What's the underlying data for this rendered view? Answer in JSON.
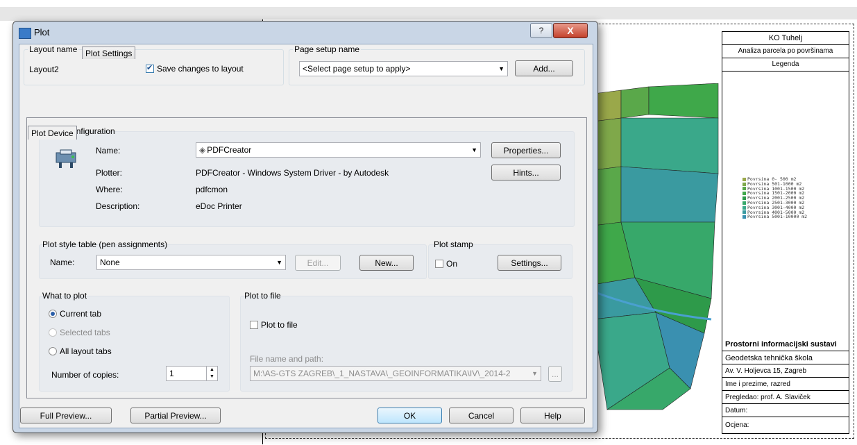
{
  "dialog": {
    "title": "Plot",
    "help_glyph": "?",
    "close_glyph": "X",
    "layout_name": {
      "label": "Layout name",
      "value": "Layout2",
      "save_changes_label": "Save changes to layout",
      "save_changes_checked": true
    },
    "page_setup": {
      "label": "Page setup name",
      "value": "<Select page setup to apply>",
      "add_button": "Add..."
    },
    "tabs": [
      {
        "label": "Plot Device",
        "active": true
      },
      {
        "label": "Plot Settings",
        "active": false
      }
    ],
    "plotter_configuration": {
      "label": "Plotter configuration",
      "name_label": "Name:",
      "name_value": "PDFCreator",
      "plotter_label": "Plotter:",
      "plotter_value": "PDFCreator - Windows System Driver - by Autodesk",
      "where_label": "Where:",
      "where_value": "pdfcmon",
      "description_label": "Description:",
      "description_value": "eDoc Printer",
      "properties_button": "Properties...",
      "hints_button": "Hints..."
    },
    "plot_style_table": {
      "label": "Plot style table (pen assignments)",
      "name_label": "Name:",
      "name_value": "None",
      "edit_button": "Edit...",
      "new_button": "New..."
    },
    "plot_stamp": {
      "label": "Plot stamp",
      "on_label": "On",
      "on_checked": false,
      "settings_button": "Settings..."
    },
    "what_to_plot": {
      "label": "What to plot",
      "options": [
        {
          "label": "Current tab",
          "selected": true,
          "enabled": true
        },
        {
          "label": "Selected tabs",
          "selected": false,
          "enabled": false
        },
        {
          "label": "All layout tabs",
          "selected": false,
          "enabled": true
        }
      ],
      "copies_label": "Number of copies:",
      "copies_value": "1"
    },
    "plot_to_file": {
      "label": "Plot to file",
      "checkbox_label": "Plot to file",
      "checked": false,
      "path_label": "File name and path:",
      "path_value": "M:\\AS-GTS ZAGREB\\_1_NASTAVA\\_GEOINFORMATIKA\\IV\\_2014-2",
      "browse_button": "..."
    },
    "footer": {
      "full_preview": "Full Preview...",
      "partial_preview": "Partial Preview...",
      "ok": "OK",
      "cancel": "Cancel",
      "help": "Help"
    }
  },
  "drawing": {
    "title_block": {
      "title": "KO Tuhelj",
      "subtitle": "Analiza parcela po površinama",
      "legend_header": "Legenda",
      "rows": [
        "Prostorni informacijski sustavi",
        "Geodetska tehnička škola",
        "Av. V. Holjevca 15, Zagreb",
        "Ime i prezime, razred",
        "Pregledao: prof. A. Slaviček",
        "Datum:",
        "Ocjena:"
      ]
    },
    "legend_items": [
      {
        "label": "Povrsina  0- 500 m2",
        "color": "#9aa84a"
      },
      {
        "label": "Povrsina 501-1000 m2",
        "color": "#7fa84a"
      },
      {
        "label": "Povrsina 1001-1500 m2",
        "color": "#5aa84a"
      },
      {
        "label": "Povrsina 1501-2000 m2",
        "color": "#3fa84a"
      },
      {
        "label": "Povrsina 2001-2500 m2",
        "color": "#2e9a4a"
      },
      {
        "label": "Povrsina 2501-3000 m2",
        "color": "#37a86a"
      },
      {
        "label": "Povrsina 3001-4000 m2",
        "color": "#3aa88a"
      },
      {
        "label": "Povrsina 4001-5000 m2",
        "color": "#3a9aa0"
      },
      {
        "label": "Povrsina 5001-10000 m2",
        "color": "#3a90b0"
      }
    ]
  }
}
